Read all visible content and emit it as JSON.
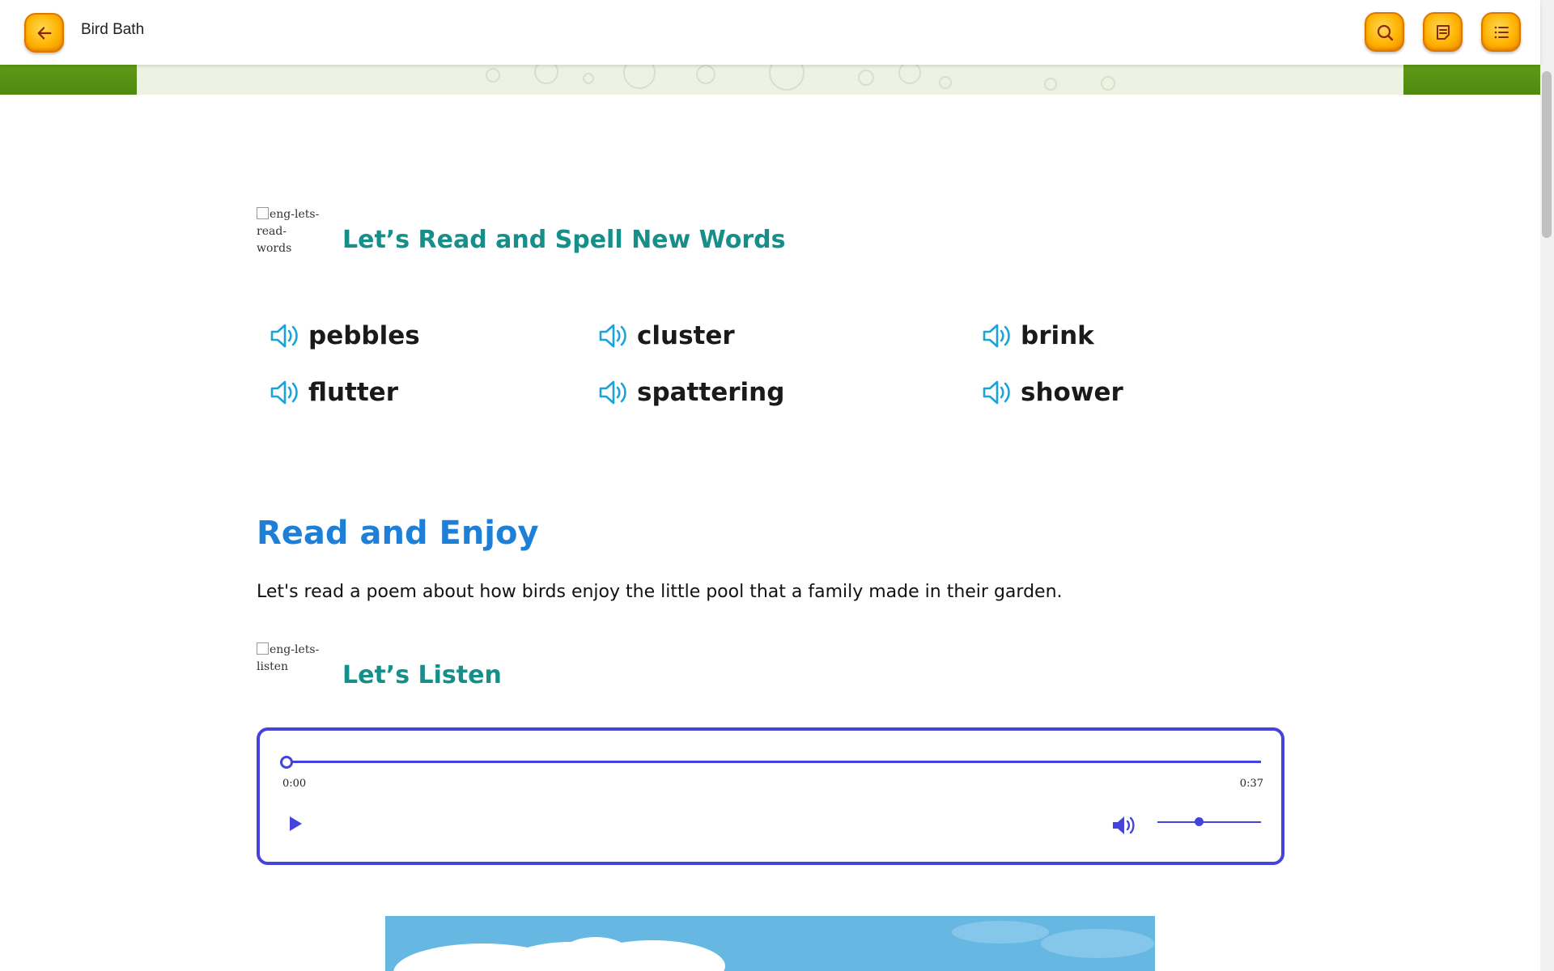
{
  "header": {
    "title": "Bird Bath"
  },
  "section_words": {
    "icon_alt": "eng-lets-read-words",
    "heading": "Let’s Read and Spell New Words"
  },
  "words": [
    "pebbles",
    "cluster",
    "brink",
    "flutter",
    "spattering",
    "shower"
  ],
  "read_enjoy": {
    "title": "Read and Enjoy",
    "description": "Let's read a poem about how birds enjoy the little pool that a family made in their garden."
  },
  "section_listen": {
    "icon_alt": "eng-lets-listen",
    "heading": "Let’s Listen"
  },
  "audio": {
    "current_time": "0:00",
    "duration": "0:37",
    "progress": 0,
    "volume": 0.4
  },
  "colors": {
    "accent_button": "#ffb300",
    "heading_teal": "#168f8a",
    "title_blue": "#1e7fd6",
    "speaker_blue": "#1aa3d9",
    "player_border": "#4444dd"
  },
  "icons": {
    "back": "arrow-left-icon",
    "search": "search-icon",
    "notes": "notes-icon",
    "menu": "list-menu-icon",
    "word_audio": "speaker-icon",
    "play": "play-icon",
    "volume": "volume-icon"
  }
}
